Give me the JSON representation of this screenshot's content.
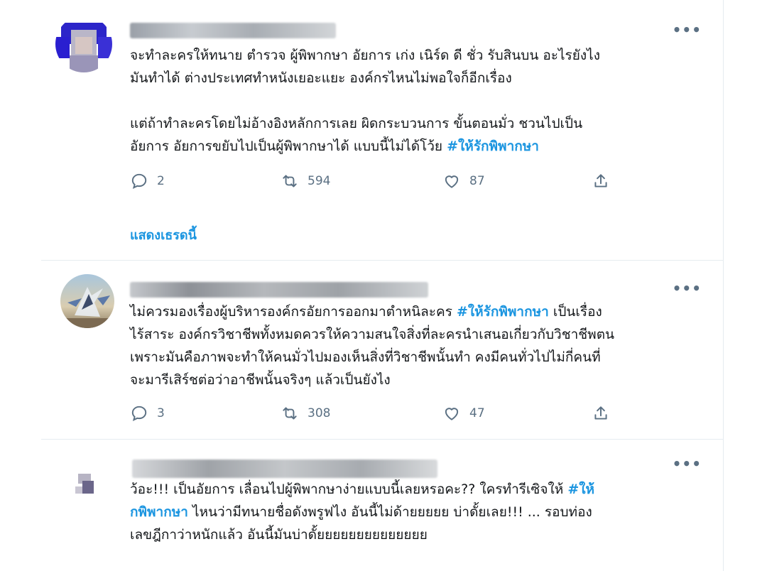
{
  "tweets": [
    {
      "text_before": "จะทำละครให้ทนาย ตำรวจ ผู้พิพากษา อัยการ เก่ง เนิร์ด ดี ชั่ว รับสินบน อะไรยังไง\nมันทำได้ ต่างประเทศทำหนังเยอะแยะ องค์กรไหนไม่พอใจก็อีกเรื่อง\n\nแต่ถ้าทำละครโดยไม่อ้างอิงหลักการเลย ผิดกระบวนการ ขั้นตอนมั่ว ชวนไปเป็น\nอัยการ อัยการขยับไปเป็นผู้พิพากษาได้ แบบนี้ไม่ได้โว้ย ",
      "hashtag": "#ให้รักพิพากษา",
      "text_after": "",
      "replies": "2",
      "retweets": "594",
      "likes": "87",
      "show_thread": "แสดงเธรดนี้"
    },
    {
      "text_before": "ไม่ควรมองเรื่องผู้บริหารองค์กรอัยการออกมาตำหนิละคร ",
      "hashtag": "#ให้รักพิพากษา",
      "text_after": " เป็นเรื่อง\nไร้สาระ องค์กรวิชาชีพทั้งหมดควรให้ความสนใจสิ่งที่ละครนำเสนอเกี่ยวกับวิชาชีพตน\nเพราะมันคือภาพจะทำให้คนมั่วไปมองเห็นสิ่งที่วิชาชีพนั้นทำ คงมีคนทั่วไปไม่กี่คนที่\nจะมารีเสิร์ชต่อว่าอาชีพนั้นจริงๆ แล้วเป็นยังไง",
      "replies": "3",
      "retweets": "308",
      "likes": "47"
    },
    {
      "text_before": "ว้อะ!!! เป็นอัยการ เลื่อนไปผู้พิพากษาง่ายแบบนี้เลยหรอคะ?? ใครทำรีเซิจให้ ",
      "hashtag_a": "#ให้",
      "hashtag_b": "กพิพากษา",
      "text_after": " ไหนว่ามีทนายชื่อดังพรูฟไง อันนี้ไม่ด้ายยยยย บ่าดั้ยเลย!!! ... รอบท่อง\nเลขฎีกาว่าหนักแล้ว อันนี้มันบ่าดั้ยยยยยยยยยยยยยย"
    }
  ],
  "more_label": "•••",
  "colors": {
    "accent": "#1b95e0",
    "muted": "#5b7083",
    "border": "#e6ecf0"
  }
}
